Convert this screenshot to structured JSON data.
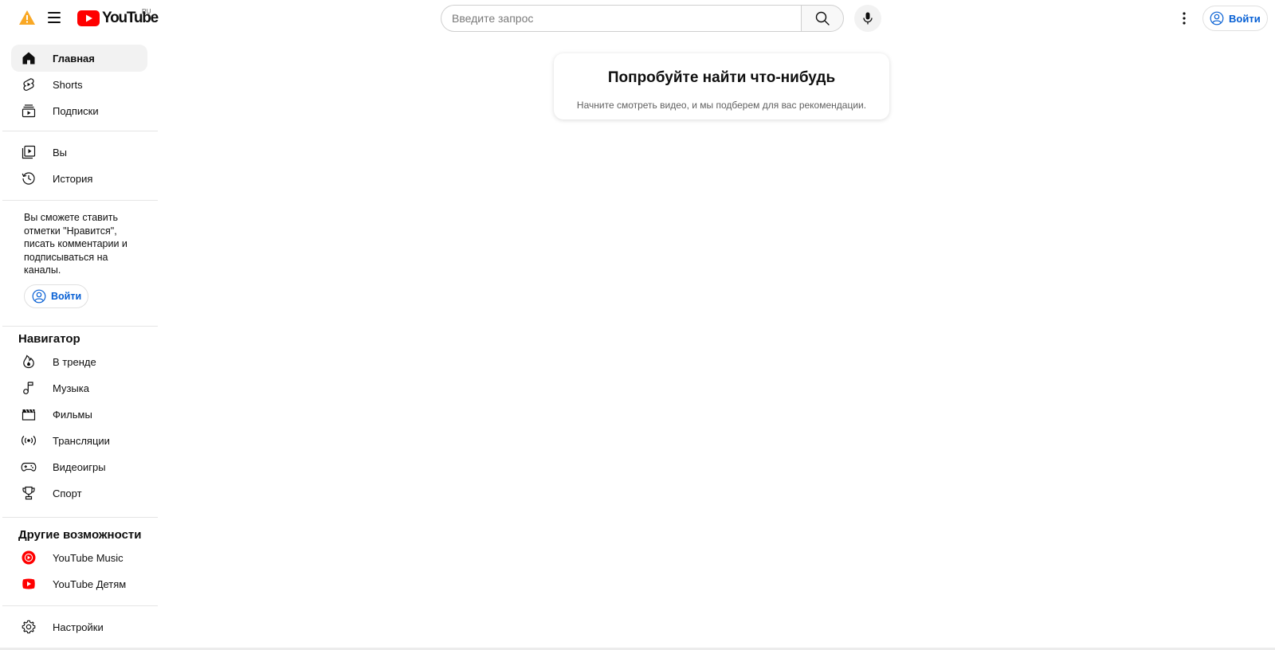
{
  "header": {
    "logo_text": "YouTube",
    "region": "RU",
    "search_placeholder": "Введите запрос",
    "signin_label": "Войти",
    "brand_color": "#ff0000",
    "link_color": "#065fd4",
    "warning_color": "#f9a825"
  },
  "sidebar": {
    "main_items": [
      {
        "label": "Главная",
        "icon": "home-icon",
        "active": true
      },
      {
        "label": "Shorts",
        "icon": "shorts-icon"
      },
      {
        "label": "Подписки",
        "icon": "subscriptions-icon"
      }
    ],
    "you_items": [
      {
        "label": "Вы",
        "icon": "library-icon"
      },
      {
        "label": "История",
        "icon": "history-icon"
      }
    ],
    "promo_text": "Вы сможете ставить отметки \"Нравится\", писать комментарии и подписываться на каналы.",
    "signin_label": "Войти",
    "explore_title": "Навигатор",
    "explore_items": [
      {
        "label": "В тренде",
        "icon": "trending-icon"
      },
      {
        "label": "Музыка",
        "icon": "music-icon"
      },
      {
        "label": "Фильмы",
        "icon": "movies-icon"
      },
      {
        "label": "Трансляции",
        "icon": "live-icon"
      },
      {
        "label": "Видеоигры",
        "icon": "gaming-icon"
      },
      {
        "label": "Спорт",
        "icon": "sports-icon"
      }
    ],
    "more_title": "Другие возможности",
    "more_items": [
      {
        "label": "YouTube Music",
        "icon": "youtube-music-icon"
      },
      {
        "label": "YouTube Детям",
        "icon": "youtube-kids-icon"
      }
    ],
    "settings_items": [
      {
        "label": "Настройки",
        "icon": "settings-icon"
      }
    ]
  },
  "main": {
    "card_title": "Попробуйте найти что-нибудь",
    "card_subtitle": "Начните смотреть видео, и мы подберем для вас рекомендации."
  }
}
